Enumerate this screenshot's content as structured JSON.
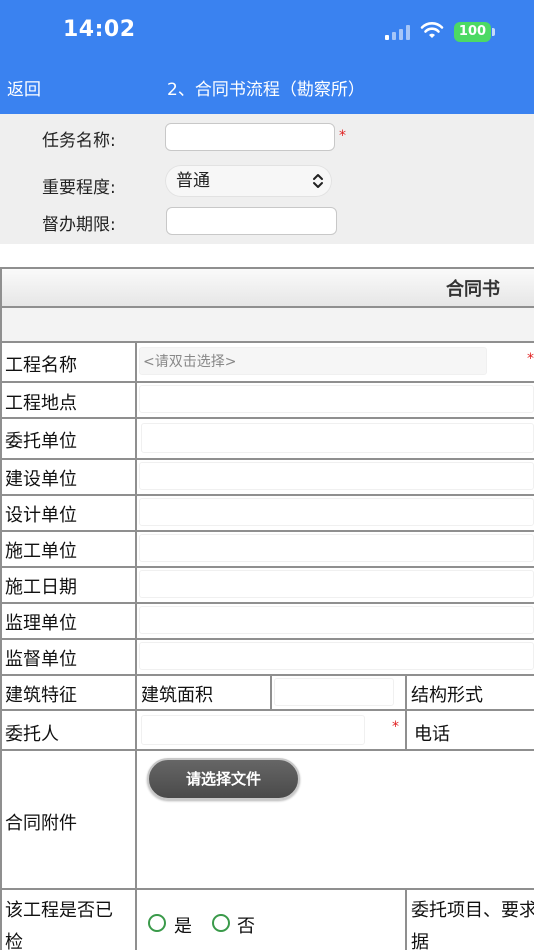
{
  "status_bar": {
    "time": "14:02",
    "battery": "100"
  },
  "nav": {
    "back_label": "返回",
    "title": "2、合同书流程（勘察所）"
  },
  "task": {
    "name_label": "任务名称:",
    "importance_label": "重要程度:",
    "importance_value": "普通",
    "deadline_label": "督办期限:",
    "required_mark": "*"
  },
  "form": {
    "header_title": "合同书",
    "project_name_label": "工程名称",
    "project_name_placeholder": "<请双击选择>",
    "project_address_label": "工程地点",
    "client_unit_label": "委托单位",
    "construction_unit_label": "建设单位",
    "design_unit_label": "设计单位",
    "builder_unit_label": "施工单位",
    "build_date_label": "施工日期",
    "supervision_unit_label": "监理单位",
    "oversight_unit_label": "监督单位",
    "building_feature_label": "建筑特征",
    "building_area_label": "建筑面积",
    "structure_form_label": "结构形式",
    "client_person_label": "委托人",
    "phone_label": "电话",
    "attachment_label": "合同附件",
    "file_button_label": "请选择文件",
    "inspected_label_1": "该工程是否已",
    "inspected_label_2": "检",
    "yes_label": "是",
    "no_label": "否",
    "client_items_label_1": "委托项目、要求",
    "client_items_label_2": "据",
    "required_mark": "*"
  },
  "colors": {
    "nav_blue": "#3a82f0",
    "required_red": "#e02020",
    "radio_green": "#3a9a4a"
  }
}
